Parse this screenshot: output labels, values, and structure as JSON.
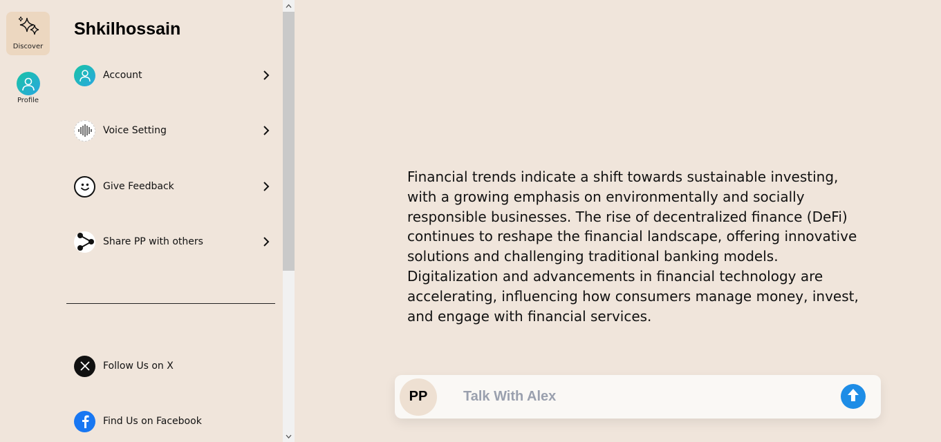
{
  "rail": {
    "discover_label": "Discover",
    "profile_label": "Profile"
  },
  "panel": {
    "username": "Shkilhossain",
    "menu": [
      {
        "label": "Account",
        "icon": "user-icon"
      },
      {
        "label": "Voice Setting",
        "icon": "waveform-icon"
      },
      {
        "label": "Give Feedback",
        "icon": "smiley-icon"
      },
      {
        "label": "Share PP with others",
        "icon": "share-icon"
      }
    ],
    "social": [
      {
        "label": "Follow Us on X",
        "icon": "x-logo-icon"
      },
      {
        "label": "Find Us on Facebook",
        "icon": "facebook-icon"
      }
    ]
  },
  "main": {
    "response_text": "Financial trends indicate a shift towards sustainable investing, with a growing emphasis on environmentally and socially responsible businesses. The rise of decentralized finance (DeFi) continues to reshape the financial landscape, offering innovative solutions and challenging traditional banking models. Digitalization and advancements in financial technology are accelerating, influencing how consumers manage money, invest, and engage with financial services.",
    "chat": {
      "avatar_text": "PP",
      "placeholder": "Talk With Alex",
      "value": ""
    }
  },
  "colors": {
    "background": "#f0e5db",
    "accent_blue": "#1e8de6",
    "active_rail": "#ecd7c0"
  }
}
